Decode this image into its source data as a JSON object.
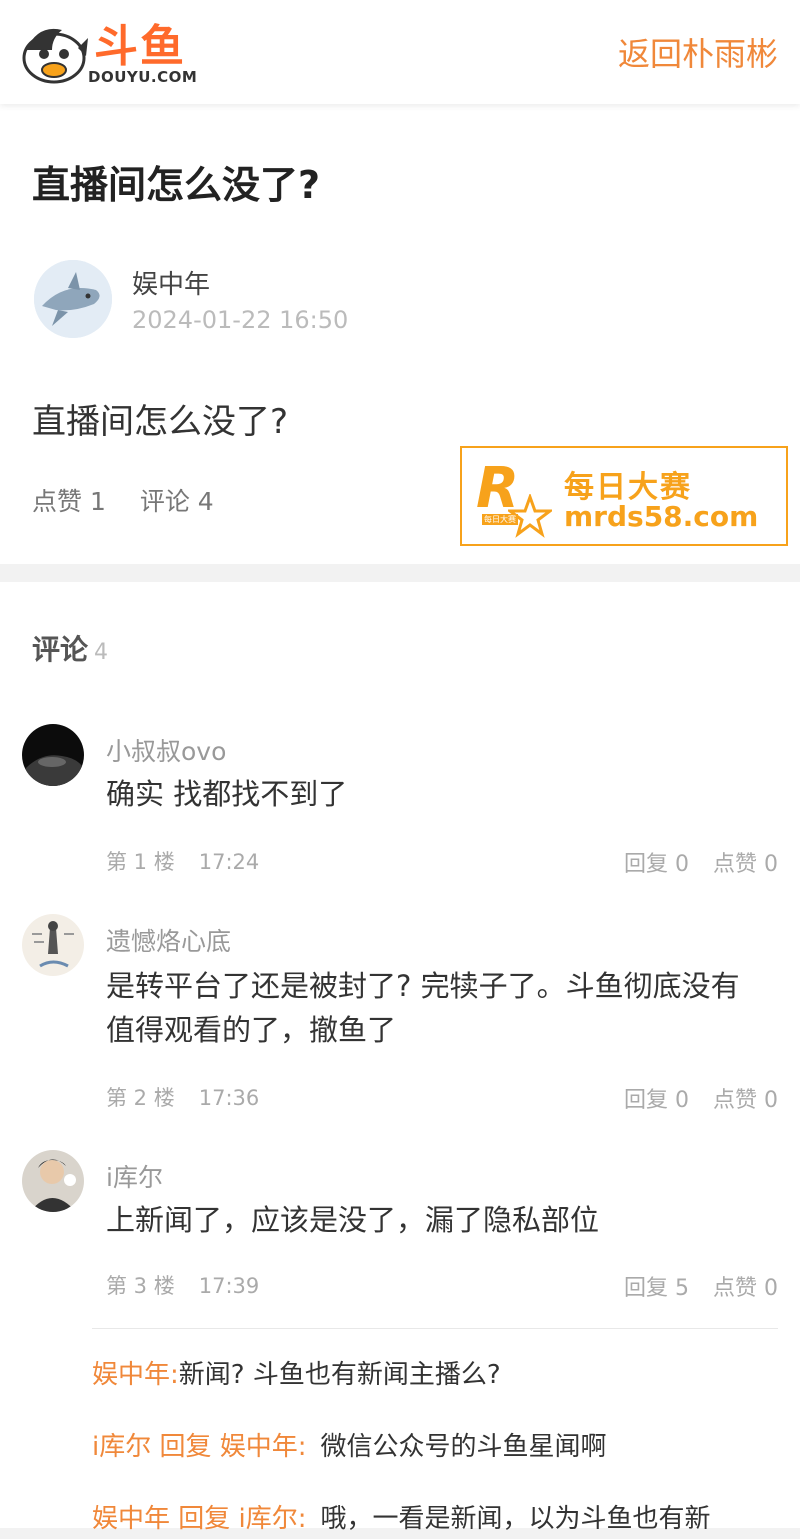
{
  "header": {
    "logo_text": "斗鱼",
    "logo_domain": "DOUYU.COM",
    "back_link": "返回朴雨彬"
  },
  "post": {
    "title": "直播间怎么没了?",
    "author": "娱中年",
    "date": "2024-01-22 16:50",
    "body": "直播间怎么没了?",
    "likes": "点赞 1",
    "comments": "评论 4"
  },
  "watermark": {
    "letter": "R",
    "small": "每日大赛",
    "title": "每日大赛",
    "domain": "mrds58.com"
  },
  "comments_section": {
    "heading": "评论",
    "count": "4",
    "items": [
      {
        "user": "小叔叔ovo",
        "text": "确实 找都找不到了",
        "floor": "第 1 楼",
        "time": "17:24",
        "reply": "回复 0",
        "like": "点赞 0"
      },
      {
        "user": "遗憾烙心底",
        "text": "是转平台了还是被封了? 完犊子了。斗鱼彻底没有值得观看的了，撤鱼了",
        "floor": "第 2 楼",
        "time": "17:36",
        "reply": "回复 0",
        "like": "点赞 0"
      },
      {
        "user": "i库尔",
        "text": "上新闻了，应该是没了，漏了隐私部位",
        "floor": "第 3 楼",
        "time": "17:39",
        "reply": "回复 5",
        "like": "点赞 0"
      }
    ],
    "replies": [
      {
        "from": "娱中年:",
        "mid": "",
        "text": "新闻? 斗鱼也有新闻主播么?"
      },
      {
        "from": "i库尔",
        "mid": " 回复 娱中年:",
        "text": "微信公众号的斗鱼星闻啊"
      },
      {
        "from": "娱中年",
        "mid": " 回复 i库尔:",
        "text": "哦，一看是新闻，以为斗鱼也有新"
      }
    ]
  },
  "colors": {
    "accent": "#f0883a",
    "brand": "#ff6a2b",
    "watermark": "#f7a21b"
  }
}
